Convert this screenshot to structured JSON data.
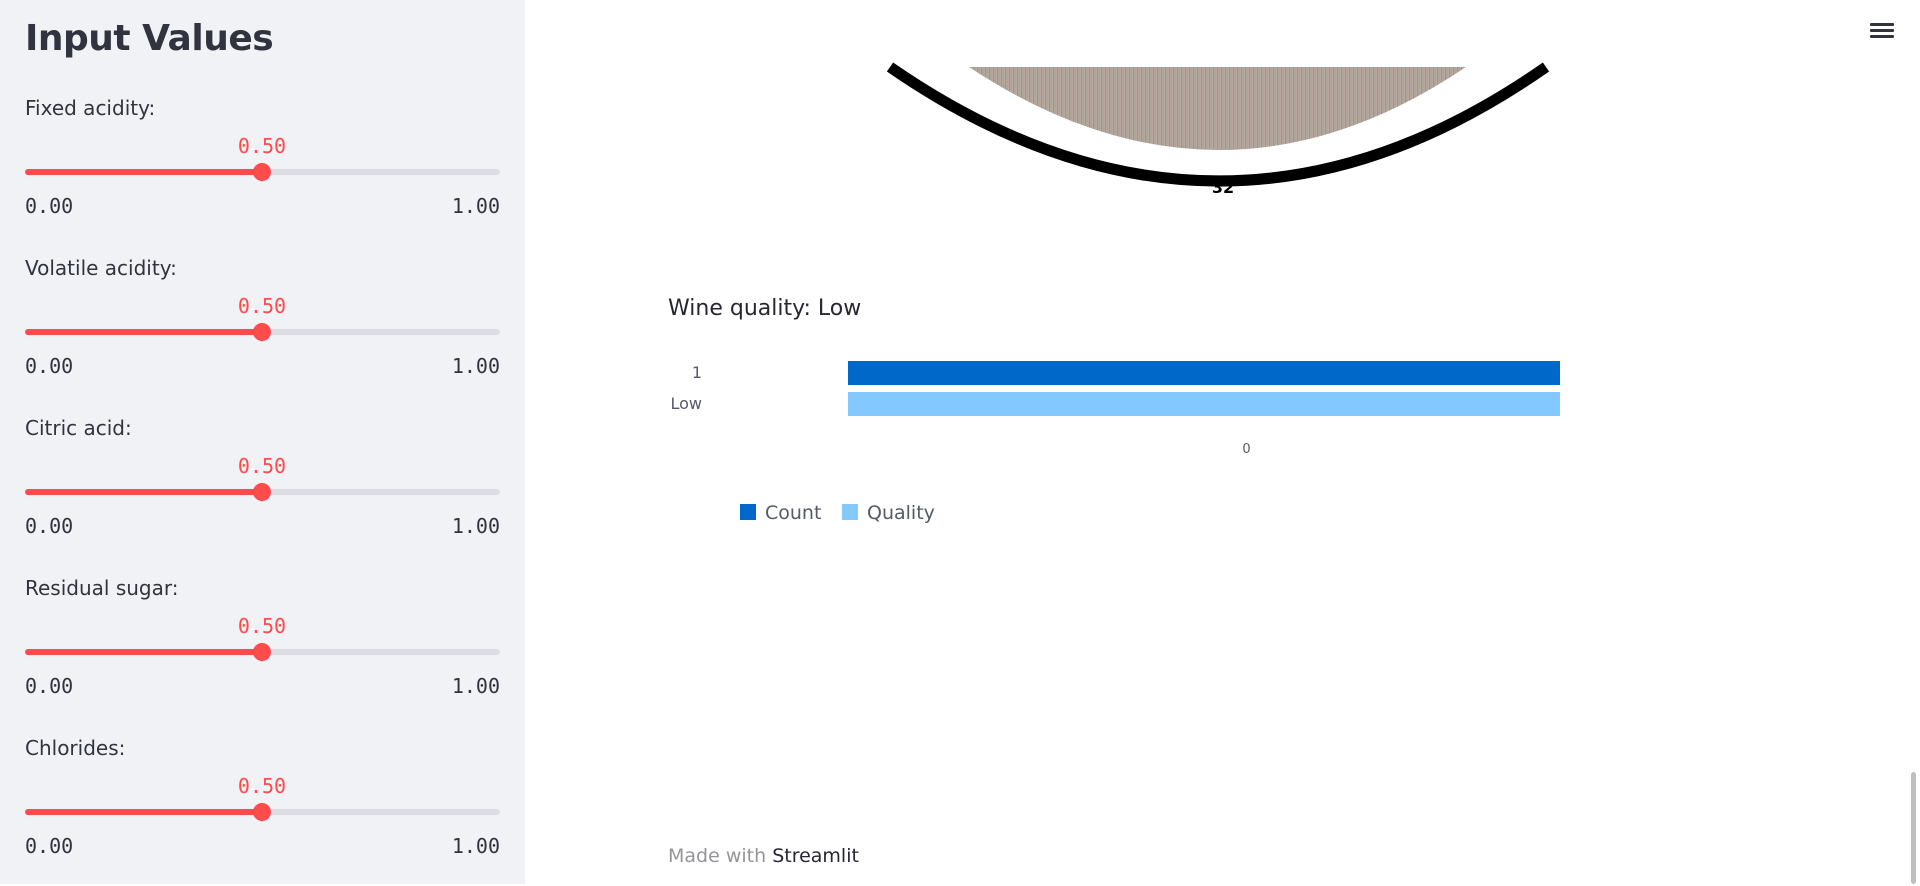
{
  "sidebar": {
    "title": "Input Values",
    "sliders": [
      {
        "label": "Fixed acidity:",
        "value": "0.50",
        "min": "0.00",
        "max": "1.00",
        "fraction": 0.5
      },
      {
        "label": "Volatile acidity:",
        "value": "0.50",
        "min": "0.00",
        "max": "1.00",
        "fraction": 0.5
      },
      {
        "label": "Citric acid:",
        "value": "0.50",
        "min": "0.00",
        "max": "1.00",
        "fraction": 0.5
      },
      {
        "label": "Residual sugar:",
        "value": "0.50",
        "min": "0.00",
        "max": "1.00",
        "fraction": 0.5
      },
      {
        "label": "Chlorides:",
        "value": "0.50",
        "min": "0.00",
        "max": "1.00",
        "fraction": 0.5
      }
    ]
  },
  "gauge": {
    "visible_label": "32"
  },
  "main": {
    "quality_title": "Wine quality: Low"
  },
  "chart_data": {
    "type": "bar",
    "orientation": "horizontal",
    "categories": [
      "1",
      "Low"
    ],
    "series": [
      {
        "name": "Count",
        "values": [
          1
        ],
        "color": "#0068c9"
      },
      {
        "name": "Quality",
        "values": [
          1
        ],
        "color": "#83c9ff"
      }
    ],
    "x_tick_labels": [
      "0"
    ],
    "legend_placement": "bottom-left",
    "grid": false
  },
  "footer": {
    "prefix": "Made with",
    "brand": "Streamlit"
  },
  "colors": {
    "accent": "#ff4b4b",
    "sidebar_bg": "#f0f2f6"
  },
  "icons": {
    "menu": "hamburger-menu-icon"
  }
}
